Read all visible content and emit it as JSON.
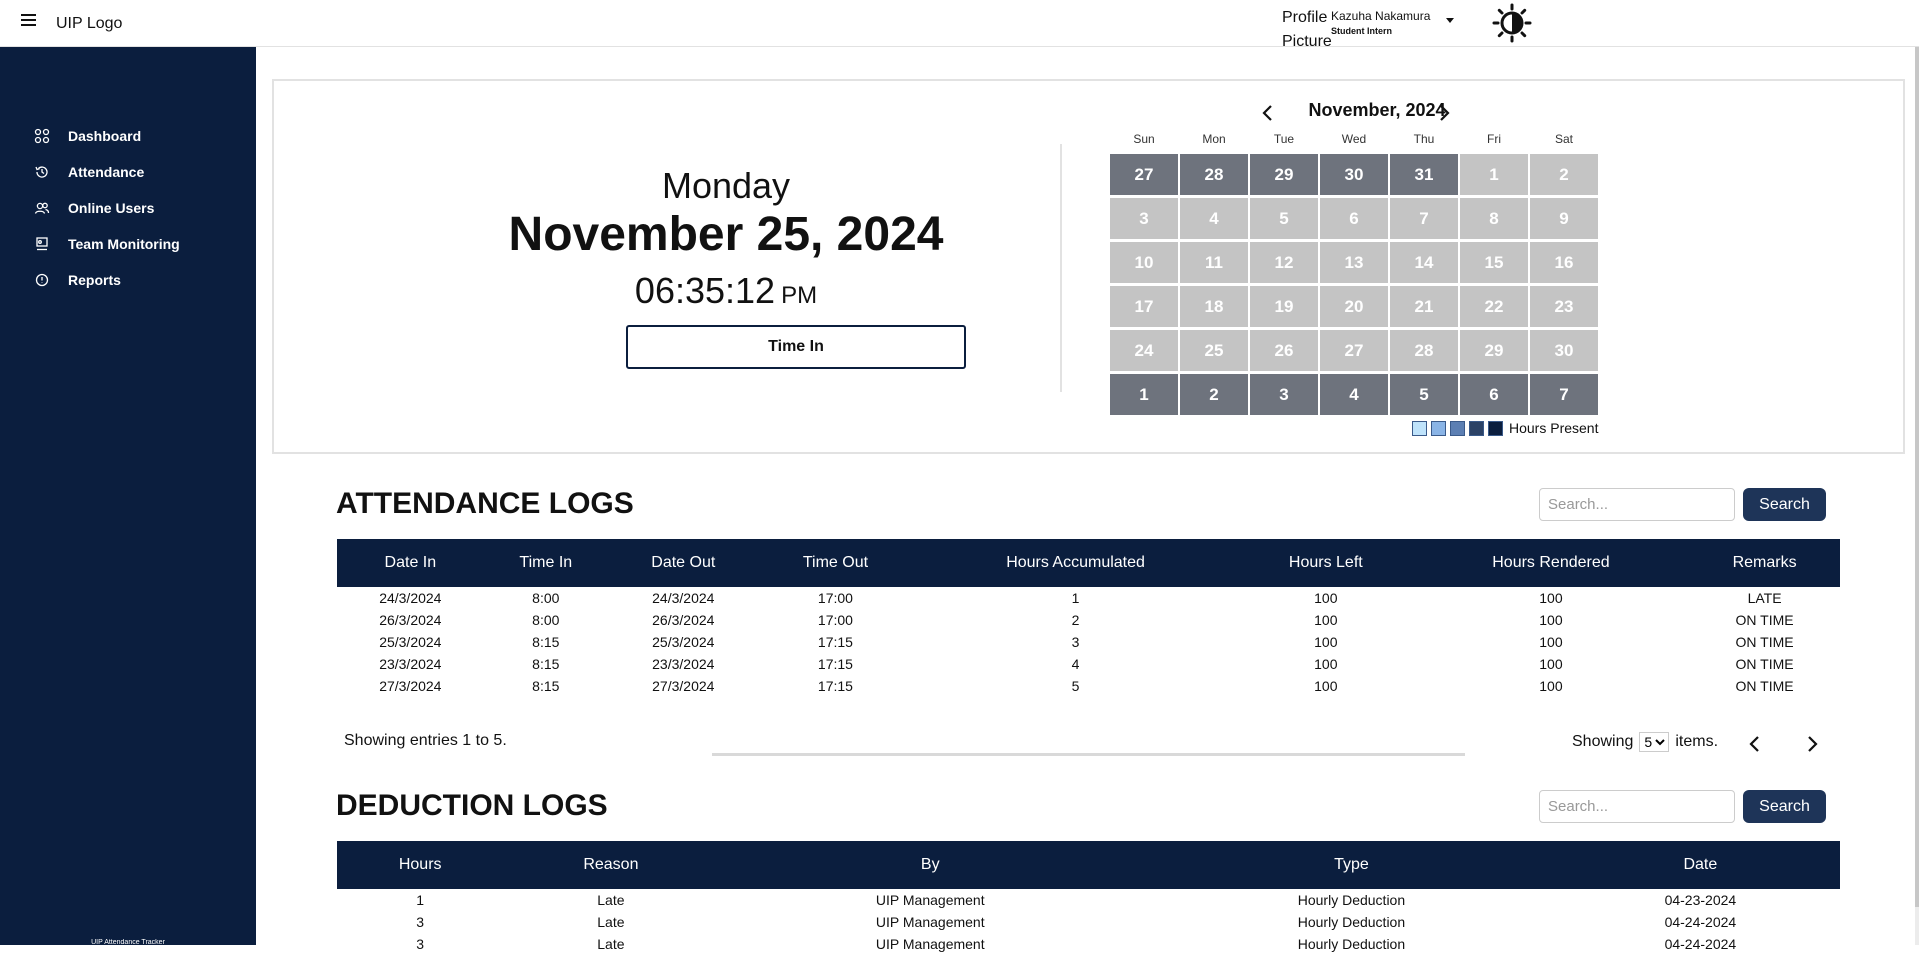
{
  "header": {
    "logo": "UIP Logo",
    "profile_picture_alt": "Profile Picture",
    "user_name": "Kazuha Nakamura",
    "user_role": "Student Intern"
  },
  "sidebar": {
    "items": [
      {
        "label": "Dashboard",
        "icon": "grid-icon"
      },
      {
        "label": "Attendance",
        "icon": "history-icon"
      },
      {
        "label": "Online Users",
        "icon": "users-icon"
      },
      {
        "label": "Team Monitoring",
        "icon": "monitor-icon"
      },
      {
        "label": "Reports",
        "icon": "alert-circle-icon"
      }
    ],
    "footer": "UIP Attendance Tracker"
  },
  "clock": {
    "day": "Monday",
    "date": "November 25, 2024",
    "time": "06:35:12",
    "ampm": "PM",
    "time_in_label": "Time In"
  },
  "calendar": {
    "title": "November, 2024",
    "weekdays": [
      "Sun",
      "Mon",
      "Tue",
      "Wed",
      "Thu",
      "Fri",
      "Sat"
    ],
    "days": [
      {
        "d": "27",
        "other": true
      },
      {
        "d": "28",
        "other": true
      },
      {
        "d": "29",
        "other": true
      },
      {
        "d": "30",
        "other": true
      },
      {
        "d": "31",
        "other": true
      },
      {
        "d": "1",
        "other": false
      },
      {
        "d": "2",
        "other": false
      },
      {
        "d": "3",
        "other": false
      },
      {
        "d": "4",
        "other": false
      },
      {
        "d": "5",
        "other": false
      },
      {
        "d": "6",
        "other": false
      },
      {
        "d": "7",
        "other": false
      },
      {
        "d": "8",
        "other": false
      },
      {
        "d": "9",
        "other": false
      },
      {
        "d": "10",
        "other": false
      },
      {
        "d": "11",
        "other": false
      },
      {
        "d": "12",
        "other": false
      },
      {
        "d": "13",
        "other": false
      },
      {
        "d": "14",
        "other": false
      },
      {
        "d": "15",
        "other": false
      },
      {
        "d": "16",
        "other": false
      },
      {
        "d": "17",
        "other": false
      },
      {
        "d": "18",
        "other": false
      },
      {
        "d": "19",
        "other": false
      },
      {
        "d": "20",
        "other": false
      },
      {
        "d": "21",
        "other": false
      },
      {
        "d": "22",
        "other": false
      },
      {
        "d": "23",
        "other": false
      },
      {
        "d": "24",
        "other": false
      },
      {
        "d": "25",
        "other": false
      },
      {
        "d": "26",
        "other": false
      },
      {
        "d": "27",
        "other": false
      },
      {
        "d": "28",
        "other": false
      },
      {
        "d": "29",
        "other": false
      },
      {
        "d": "30",
        "other": false
      },
      {
        "d": "1",
        "other": true
      },
      {
        "d": "2",
        "other": true
      },
      {
        "d": "3",
        "other": true
      },
      {
        "d": "4",
        "other": true
      },
      {
        "d": "5",
        "other": true
      },
      {
        "d": "6",
        "other": true
      },
      {
        "d": "7",
        "other": true
      }
    ],
    "legend_colors": [
      "#bfe3fb",
      "#8ab4e6",
      "#5c7fb3",
      "#2c4266",
      "#0b1e3e"
    ],
    "legend_label": "Hours Present",
    "colors": {
      "other_month": "#6e737d",
      "current_month": "#c4c4c4"
    }
  },
  "attendance": {
    "title": "ATTENDANCE LOGS",
    "search_placeholder": "Search...",
    "search_label": "Search",
    "columns": [
      "Date In",
      "Time In",
      "Date Out",
      "Time Out",
      "Hours Accumulated",
      "Hours Left",
      "Hours Rendered",
      "Remarks"
    ],
    "rows": [
      [
        "24/3/2024",
        "8:00",
        "24/3/2024",
        "17:00",
        "1",
        "100",
        "100",
        "LATE"
      ],
      [
        "26/3/2024",
        "8:00",
        "26/3/2024",
        "17:00",
        "2",
        "100",
        "100",
        "ON TIME"
      ],
      [
        "25/3/2024",
        "8:15",
        "25/3/2024",
        "17:15",
        "3",
        "100",
        "100",
        "ON TIME"
      ],
      [
        "23/3/2024",
        "8:15",
        "23/3/2024",
        "17:15",
        "4",
        "100",
        "100",
        "ON TIME"
      ],
      [
        "27/3/2024",
        "8:15",
        "27/3/2024",
        "17:15",
        "5",
        "100",
        "100",
        "ON TIME"
      ]
    ],
    "entries_text": "Showing entries 1 to 5.",
    "showing_label": "Showing",
    "page_size": "5",
    "items_label": "items."
  },
  "deductions": {
    "title": "DEDUCTION LOGS",
    "search_placeholder": "Search...",
    "search_label": "Search",
    "columns": [
      "Hours",
      "Reason",
      "By",
      "Type",
      "Date"
    ],
    "rows": [
      [
        "1",
        "Late",
        "UIP Management",
        "Hourly Deduction",
        "04-23-2024"
      ],
      [
        "3",
        "Late",
        "UIP Management",
        "Hourly Deduction",
        "04-24-2024"
      ],
      [
        "3",
        "Late",
        "UIP Management",
        "Hourly Deduction",
        "04-24-2024"
      ]
    ]
  }
}
